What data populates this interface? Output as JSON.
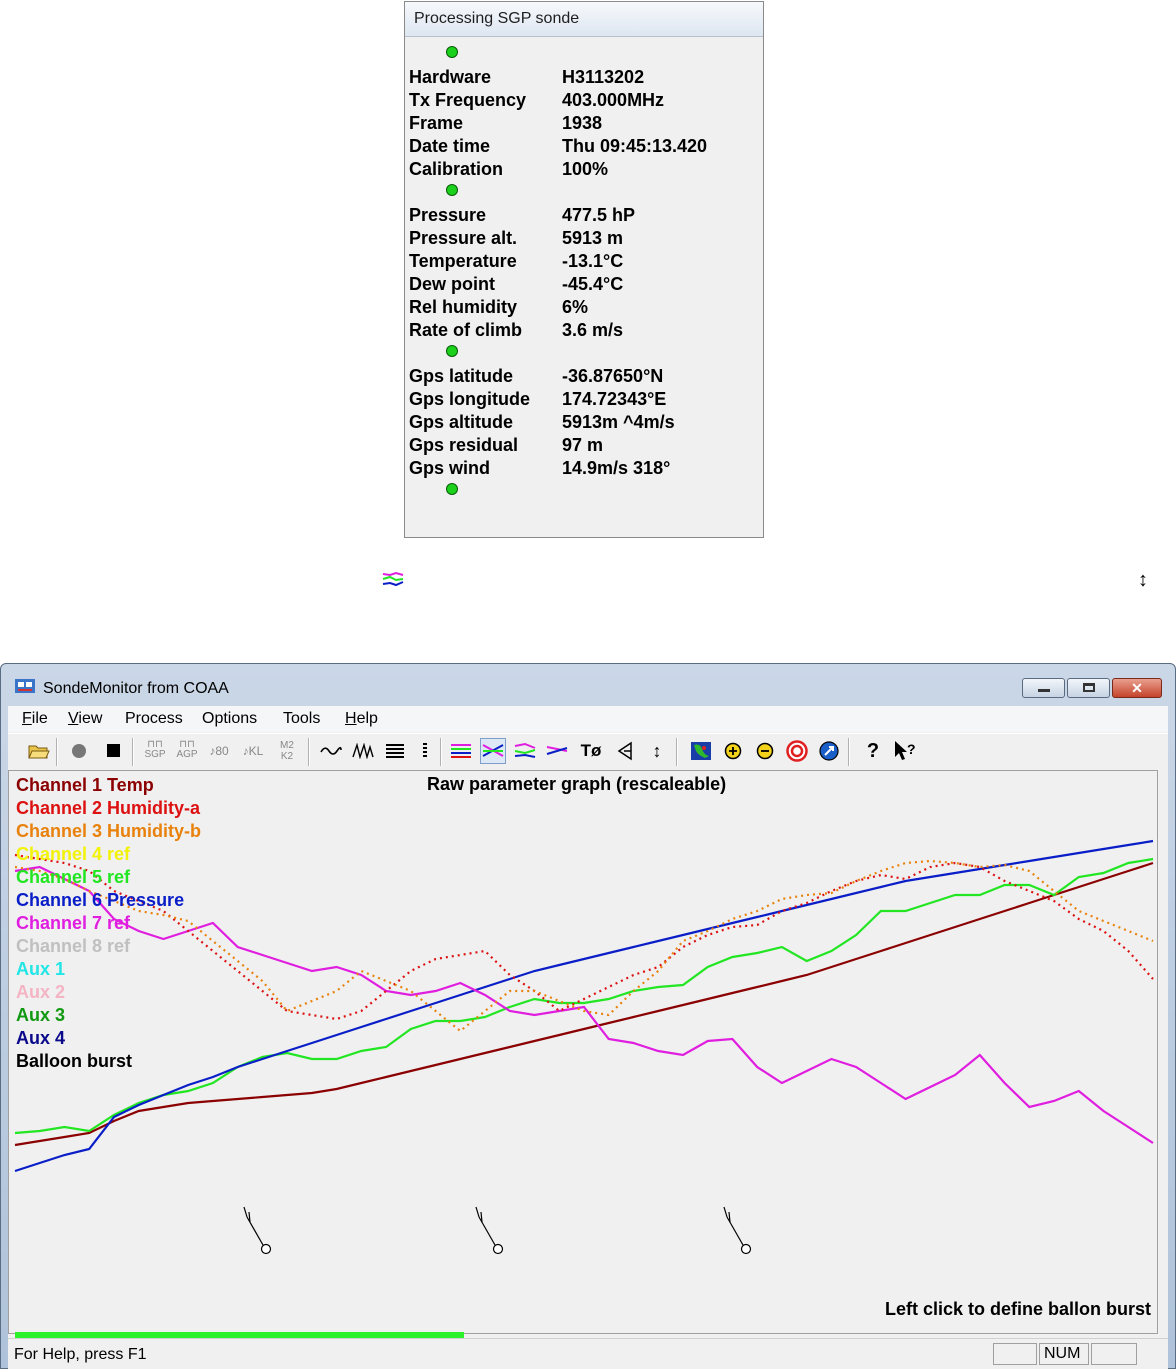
{
  "info_panel": {
    "title": "Processing SGP sonde",
    "rows": [
      {
        "label": "Hardware",
        "value": "H3113202"
      },
      {
        "label": "Tx Frequency",
        "value": "403.000MHz"
      },
      {
        "label": "Frame",
        "value": "1938"
      },
      {
        "label": "Date time",
        "value": "Thu 09:45:13.420"
      },
      {
        "label": "Calibration",
        "value": "100%"
      },
      {
        "label": "Pressure",
        "value": "477.5 hP"
      },
      {
        "label": "Pressure alt.",
        "value": "5913 m"
      },
      {
        "label": "Temperature",
        "value": "-13.1°C"
      },
      {
        "label": "Dew point",
        "value": "-45.4°C"
      },
      {
        "label": "Rel humidity",
        "value": "6%"
      },
      {
        "label": "Rate of climb",
        "value": "3.6 m/s"
      },
      {
        "label": "Gps latitude",
        "value": "-36.87650°N"
      },
      {
        "label": "Gps longitude",
        "value": "174.72343°E"
      },
      {
        "label": "Gps altitude",
        "value": "5913m ^4m/s"
      },
      {
        "label": "Gps residual",
        "value": "97 m"
      },
      {
        "label": "Gps wind",
        "value": "14.9m/s 318°"
      }
    ],
    "led_color": "#1bd11b"
  },
  "floating": {
    "arrow_glyph": "↕"
  },
  "window": {
    "title": "SondeMonitor from COAA",
    "menu": [
      {
        "label": "File",
        "accel": "F",
        "rest": "ile"
      },
      {
        "label": "View",
        "accel": "V",
        "rest": "iew"
      },
      {
        "label": "Process",
        "accel": "",
        "rest": "Process"
      },
      {
        "label": "Options",
        "accel": "",
        "rest": "Options"
      },
      {
        "label": "Tools",
        "accel": "",
        "rest": "Tools"
      },
      {
        "label": "Help",
        "accel": "H",
        "rest": "elp"
      }
    ],
    "toolbar": {
      "sgp": "SGP",
      "agp": "AGP",
      "n80": "80",
      "kl": "KL",
      "m2": "M2",
      "k2": "K2",
      "t0": "Tø",
      "help": "?"
    }
  },
  "graph": {
    "title": "Raw parameter graph (rescaleable)",
    "legend": [
      {
        "label": "Channel 1 Temp",
        "color": "#8b0000"
      },
      {
        "label": "Channel 2 Humidity-a",
        "color": "#dd1111"
      },
      {
        "label": "Channel 3 Humidity-b",
        "color": "#e8820c"
      },
      {
        "label": "Channel 4 ref",
        "color": "#f2f20a"
      },
      {
        "label": "Channel 5 ref",
        "color": "#22e622"
      },
      {
        "label": "Channel 6 Pressure",
        "color": "#0a1ec8"
      },
      {
        "label": "Channel 7 ref",
        "color": "#e01ee0"
      },
      {
        "label": "Channel 8 ref",
        "color": "#c0c0c0"
      },
      {
        "label": "Aux 1",
        "color": "#22e6e6"
      },
      {
        "label": "Aux 2",
        "color": "#f4b4c4"
      },
      {
        "label": "Aux 3",
        "color": "#119911"
      },
      {
        "label": "Aux 4",
        "color": "#0a0a8b"
      },
      {
        "label": "Balloon burst",
        "color": "#000000"
      }
    ],
    "hint": "Left click to define ballon burst",
    "progress": 0.39
  },
  "chart_data": {
    "type": "line",
    "x": [
      0,
      25,
      50,
      75,
      100,
      125,
      150,
      175,
      200,
      225,
      250,
      275,
      300,
      325,
      350,
      375,
      400,
      425,
      450,
      475,
      500,
      525,
      550,
      575,
      600,
      625,
      650,
      675,
      700,
      725,
      750,
      775,
      800,
      825,
      850,
      875,
      900,
      925,
      950,
      975,
      1000,
      1025,
      1050,
      1075,
      1100,
      1125,
      1150
    ],
    "series": [
      {
        "name": "Channel 1 Temp",
        "color": "#8b0000",
        "values": [
          73,
          75,
          77,
          79,
          85,
          90,
          92,
          94,
          95,
          96,
          97,
          98,
          99,
          101,
          104,
          107,
          110,
          113,
          116,
          119,
          122,
          125,
          128,
          131,
          134,
          137,
          140,
          143,
          146,
          149,
          152,
          155,
          158,
          162,
          166,
          170,
          174,
          178,
          182,
          186,
          190,
          194,
          198,
          202,
          206,
          210,
          214
        ]
      },
      {
        "name": "Channel 5 ref",
        "color": "#22e622",
        "values": [
          79,
          80,
          82,
          80,
          88,
          94,
          98,
          100,
          104,
          112,
          117,
          119,
          116,
          116,
          120,
          122,
          131,
          135,
          135,
          137,
          142,
          146,
          144,
          144,
          146,
          150,
          152,
          153,
          162,
          167,
          169,
          172,
          165,
          170,
          178,
          190,
          190,
          194,
          198,
          198,
          203,
          203,
          198,
          207,
          209,
          214,
          216
        ]
      },
      {
        "name": "Channel 6 Pressure",
        "color": "#0a1ec8",
        "values": [
          60,
          64,
          68,
          71,
          87,
          93,
          98,
          103,
          107,
          112,
          116,
          120,
          124,
          128,
          132,
          136,
          140,
          144,
          148,
          152,
          156,
          160,
          163,
          166,
          169,
          172,
          175,
          178,
          181,
          184,
          187,
          190,
          193,
          196,
          199,
          202,
          205,
          207,
          209,
          211,
          213,
          215,
          217,
          219,
          221,
          223,
          225
        ]
      },
      {
        "name": "Channel 7 ref",
        "color": "#e01ee0",
        "values": [
          210,
          212,
          206,
          200,
          186,
          180,
          176,
          180,
          184,
          172,
          168,
          164,
          160,
          162,
          158,
          150,
          148,
          150,
          154,
          148,
          140,
          138,
          140,
          142,
          126,
          124,
          120,
          118,
          125,
          126,
          112,
          104,
          110,
          116,
          112,
          104,
          96,
          102,
          108,
          118,
          104,
          92,
          95,
          100,
          90,
          82,
          74
        ]
      },
      {
        "name": "Channel 2 Humidity-a",
        "color": "#dd1111",
        "values": [
          218,
          216,
          214,
          210,
          200,
          195,
          190,
          180,
          170,
          160,
          150,
          140,
          138,
          136,
          140,
          150,
          160,
          166,
          168,
          170,
          158,
          150,
          140,
          146,
          152,
          158,
          162,
          172,
          178,
          182,
          183,
          190,
          194,
          200,
          205,
          208,
          206,
          212,
          214,
          212,
          205,
          200,
          195,
          186,
          180,
          170,
          156
        ]
      },
      {
        "name": "Channel 3 Humidity-b",
        "color": "#e8820c",
        "values": [
          212,
          210,
          206,
          200,
          195,
          190,
          188,
          185,
          175,
          165,
          155,
          140,
          145,
          150,
          160,
          155,
          150,
          140,
          130,
          140,
          150,
          150,
          145,
          140,
          138,
          150,
          160,
          175,
          180,
          186,
          190,
          196,
          198,
          199,
          205,
          210,
          214,
          215,
          214,
          212,
          213,
          210,
          200,
          190,
          185,
          180,
          175
        ]
      }
    ],
    "ylim": [
      0,
      230
    ]
  }
}
